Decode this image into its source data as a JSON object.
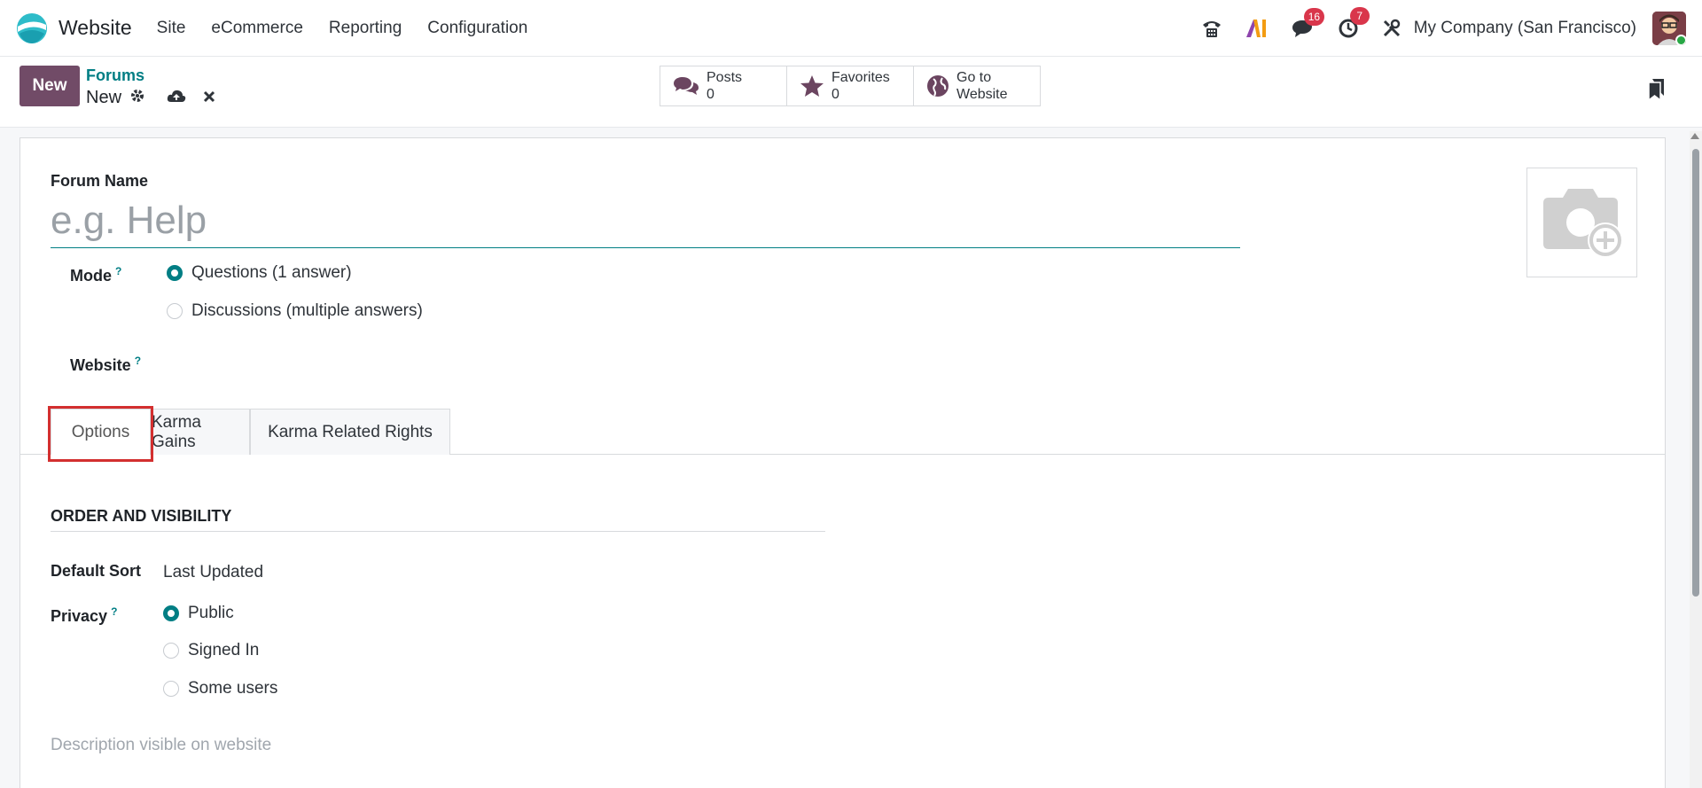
{
  "navbar": {
    "app_name": "Website",
    "menu": [
      "Site",
      "eCommerce",
      "Reporting",
      "Configuration"
    ],
    "messages_badge": "16",
    "activities_badge": "7",
    "company": "My Company (San Francisco)"
  },
  "control": {
    "new_label": "New",
    "breadcrumb_parent": "Forums",
    "breadcrumb_current": "New",
    "smart_buttons": [
      {
        "icon": "comments-icon",
        "line1": "Posts",
        "line2": "0"
      },
      {
        "icon": "star-icon",
        "line1": "Favorites",
        "line2": "0"
      },
      {
        "icon": "globe-icon",
        "line1": "Go to",
        "line2": "Website"
      }
    ]
  },
  "form": {
    "forum_name_label": "Forum Name",
    "forum_name_placeholder": "e.g. Help",
    "mode_label": "Mode",
    "help_mark": "?",
    "mode_options": [
      {
        "label": "Questions (1 answer)",
        "checked": true
      },
      {
        "label": "Discussions (multiple answers)",
        "checked": false
      }
    ],
    "website_label": "Website",
    "tabs": [
      "Options",
      "Karma Gains",
      "Karma Related Rights"
    ],
    "active_tab": "Options",
    "section_title": "ORDER AND VISIBILITY",
    "default_sort_label": "Default Sort",
    "default_sort_value": "Last Updated",
    "privacy_label": "Privacy",
    "privacy_options": [
      {
        "label": "Public",
        "checked": true
      },
      {
        "label": "Signed In",
        "checked": false
      },
      {
        "label": "Some users",
        "checked": false
      }
    ],
    "description_placeholder": "Description visible on website"
  },
  "colors": {
    "brand": "#714b67",
    "accent": "#017e84",
    "badge": "#d9364b",
    "highlight": "#d32f2f"
  }
}
